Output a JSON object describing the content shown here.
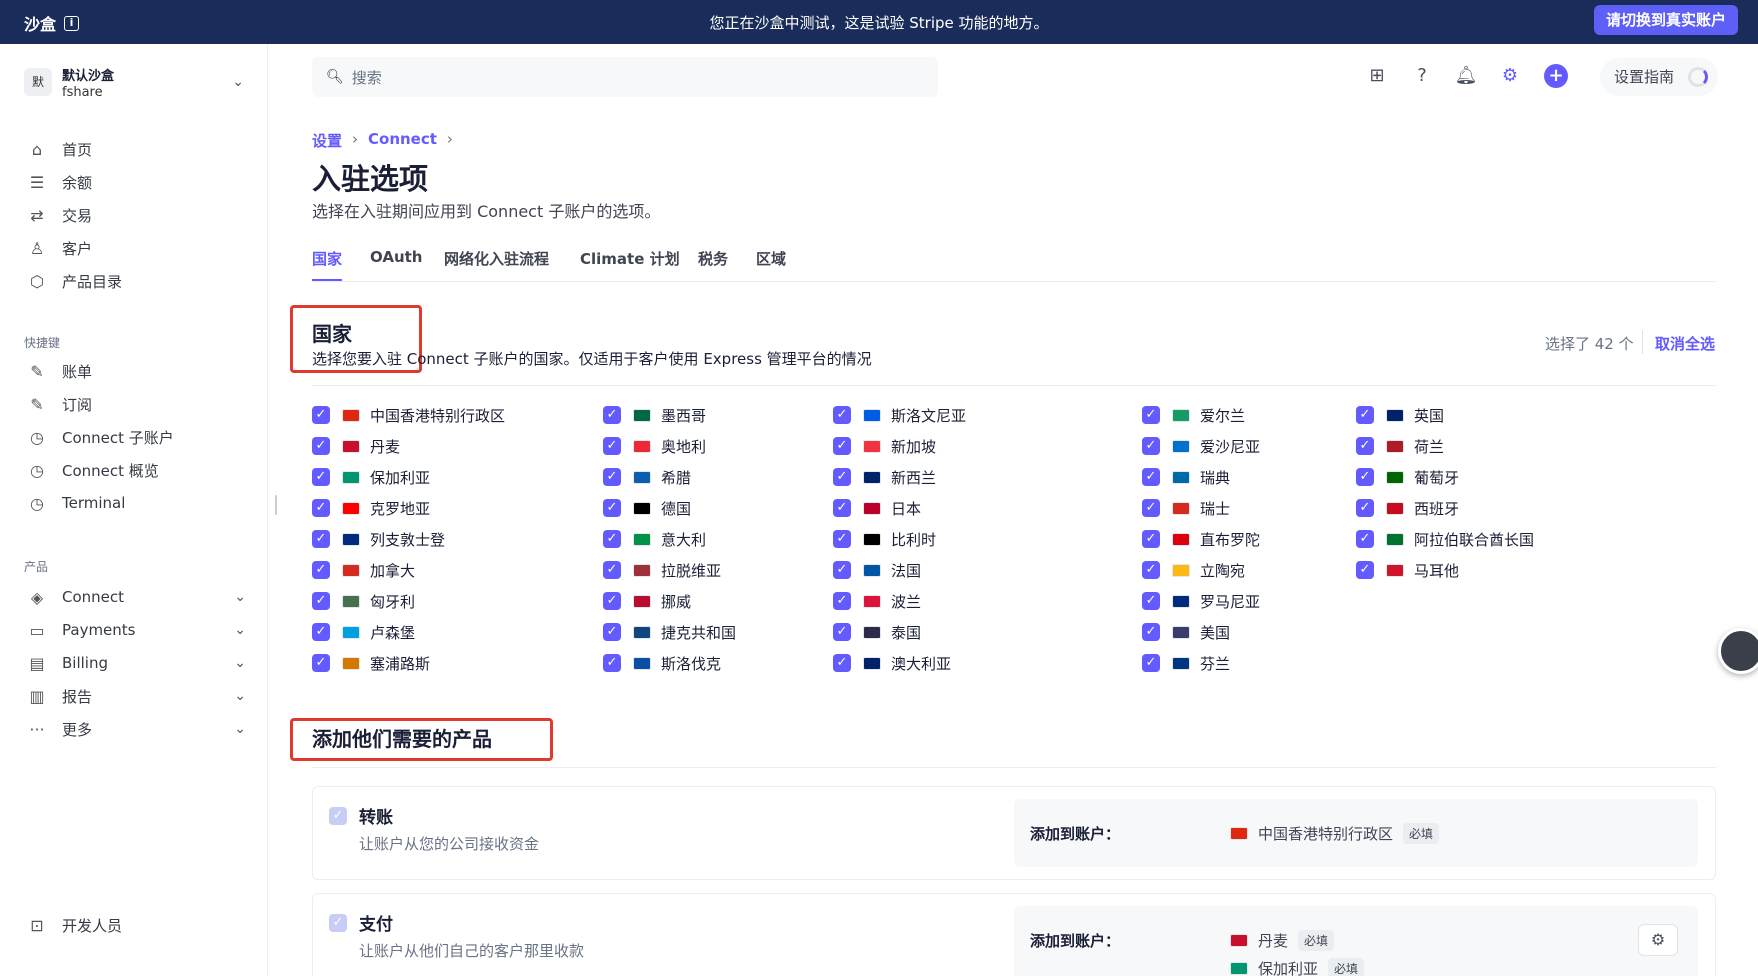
{
  "banner": {
    "left_title": "沙盒",
    "message": "您正在沙盒中测试，这是试验 Stripe 功能的地方。",
    "switch_button": "请切换到真实账户"
  },
  "account": {
    "avatar": "默",
    "name": "默认沙盒",
    "sub": "fshare"
  },
  "sidebar": {
    "main_items": [
      {
        "label": "首页",
        "icon": "home-icon"
      },
      {
        "label": "余额",
        "icon": "balance-icon"
      },
      {
        "label": "交易",
        "icon": "transactions-icon"
      },
      {
        "label": "客户",
        "icon": "customer-icon"
      },
      {
        "label": "产品目录",
        "icon": "box-icon"
      }
    ],
    "shortcuts_label": "快捷键",
    "shortcut_items": [
      {
        "label": "账单",
        "icon": "pin-icon"
      },
      {
        "label": "订阅",
        "icon": "pin-icon"
      },
      {
        "label": "Connect 子账户",
        "icon": "clock-icon"
      },
      {
        "label": "Connect 概览",
        "icon": "clock-icon"
      },
      {
        "label": "Terminal",
        "icon": "clock-icon"
      }
    ],
    "products_label": "产品",
    "product_items": [
      {
        "label": "Connect",
        "icon": "connect-icon"
      },
      {
        "label": "Payments",
        "icon": "payments-icon"
      },
      {
        "label": "Billing",
        "icon": "billing-icon"
      },
      {
        "label": "报告",
        "icon": "chart-icon"
      },
      {
        "label": "更多",
        "icon": "more-icon"
      }
    ],
    "developer": "开发人员"
  },
  "search": {
    "placeholder": "搜索"
  },
  "header": {
    "guide": "设置指南"
  },
  "breadcrumb": {
    "level1": "设置",
    "level2": "Connect"
  },
  "page": {
    "title": "入驻选项",
    "subtitle": "选择在入驻期间应用到 Connect 子账户的选项。"
  },
  "tabs": [
    "国家",
    "OAuth",
    "网络化入驻流程",
    "Climate 计划",
    "税务",
    "区域"
  ],
  "countries_section": {
    "title": "国家",
    "description": "选择您要入驻 Connect 子账户的国家。仅适用于客户使用 Express 管理平台的情况",
    "selected_count": "选择了 42 个",
    "deselect_all": "取消全选"
  },
  "countries": [
    [
      "中国香港特别行政区",
      "丹麦",
      "保加利亚",
      "克罗地亚",
      "列支敦士登",
      "加拿大",
      "匈牙利",
      "卢森堡",
      "塞浦路斯"
    ],
    [
      "墨西哥",
      "奥地利",
      "希腊",
      "德国",
      "意大利",
      "拉脱维亚",
      "挪威",
      "捷克共和国",
      "斯洛伐克"
    ],
    [
      "斯洛文尼亚",
      "新加坡",
      "新西兰",
      "日本",
      "比利时",
      "法国",
      "波兰",
      "泰国",
      "澳大利亚"
    ],
    [
      "爱尔兰",
      "爱沙尼亚",
      "瑞典",
      "瑞士",
      "直布罗陀",
      "立陶宛",
      "罗马尼亚",
      "美国",
      "芬兰"
    ],
    [
      "英国",
      "荷兰",
      "葡萄牙",
      "西班牙",
      "阿拉伯联合酋长国",
      "马耳他"
    ]
  ],
  "flag_colors": [
    [
      "#de2910",
      "#c8102e",
      "#00966e",
      "#ff0000",
      "#002b7f",
      "#d52b1e",
      "#477050",
      "#00a1de",
      "#d57800"
    ],
    [
      "#006847",
      "#ed2939",
      "#0d5eaf",
      "#000000",
      "#009246",
      "#9e3039",
      "#ba0c2f",
      "#11457e",
      "#0b4ea2"
    ],
    [
      "#005ce5",
      "#ef3340",
      "#012169",
      "#bc002d",
      "#000000",
      "#0055a4",
      "#dc143c",
      "#2d2a4a",
      "#012169"
    ],
    [
      "#169b62",
      "#0072ce",
      "#006aa7",
      "#d52b1e",
      "#da000c",
      "#fdb913",
      "#002b7f",
      "#3c3b6e",
      "#003580"
    ],
    [
      "#012169",
      "#ae1c28",
      "#006600",
      "#c60b1e",
      "#00732f",
      "#cf142b"
    ]
  ],
  "products_section": {
    "title": "添加他们需要的产品"
  },
  "product_cards": [
    {
      "title": "转账",
      "description": "让账户从您的公司接收资金",
      "add_label": "添加到账户：",
      "countries": [
        {
          "name": "中国香港特别行政区",
          "required": "必填"
        }
      ]
    },
    {
      "title": "支付",
      "description": "让账户从他们自己的客户那里收款",
      "add_label": "添加到账户：",
      "countries": [
        {
          "name": "丹麦",
          "required": "必填"
        },
        {
          "name": "保加利亚",
          "required": "必填"
        }
      ]
    }
  ]
}
